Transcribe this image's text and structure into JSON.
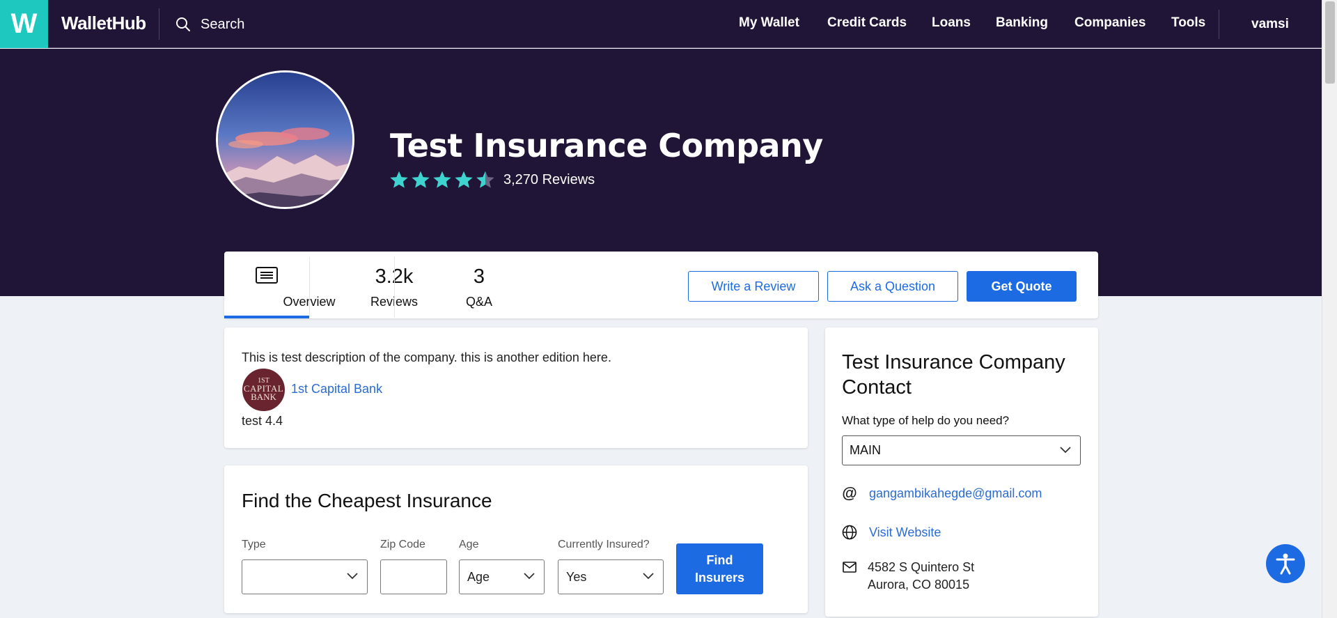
{
  "brand": {
    "logo_letter": "W",
    "name": "WalletHub"
  },
  "search": {
    "label": "Search"
  },
  "nav": {
    "links": [
      "My Wallet",
      "Credit Cards",
      "Loans",
      "Banking",
      "Companies",
      "Tools"
    ],
    "user": "vamsi"
  },
  "company": {
    "name": "Test Insurance Company",
    "rating": 4.5,
    "reviews_text": "3,270 Reviews"
  },
  "tabs": {
    "overview": "Overview",
    "reviews_count": "3.2k",
    "reviews_label": "Reviews",
    "qa_count": "3",
    "qa_label": "Q&A"
  },
  "actions": {
    "write_review": "Write a Review",
    "ask_question": "Ask a Question",
    "get_quote": "Get Quote"
  },
  "description": {
    "text": "This is test description of the company. this is another edition here.",
    "bank_logo": {
      "line1": "1ST",
      "line2": "CAPITAL",
      "line3": "BANK"
    },
    "bank_link": "1st Capital Bank",
    "rating_note": "test 4.4"
  },
  "insurance": {
    "title": "Find the Cheapest Insurance",
    "labels": {
      "type": "Type",
      "zip": "Zip Code",
      "age": "Age",
      "insured": "Currently Insured?"
    },
    "values": {
      "type": "",
      "zip": "",
      "age": "Age",
      "insured": "Yes"
    },
    "button": "Find Insurers"
  },
  "contact": {
    "title": "Test Insurance Company Contact",
    "help_label": "What type of help do you need?",
    "help_value": "MAIN",
    "email": "gangambikahegde@gmail.com",
    "website": "Visit Website",
    "address_line1": "4582 S Quintero St",
    "address_line2": "Aurora, CO 80015"
  },
  "colors": {
    "nav_bg": "#211537",
    "logo_bg": "#1ec8bf",
    "accent": "#1c6be3",
    "star": "#3fd3cf"
  }
}
